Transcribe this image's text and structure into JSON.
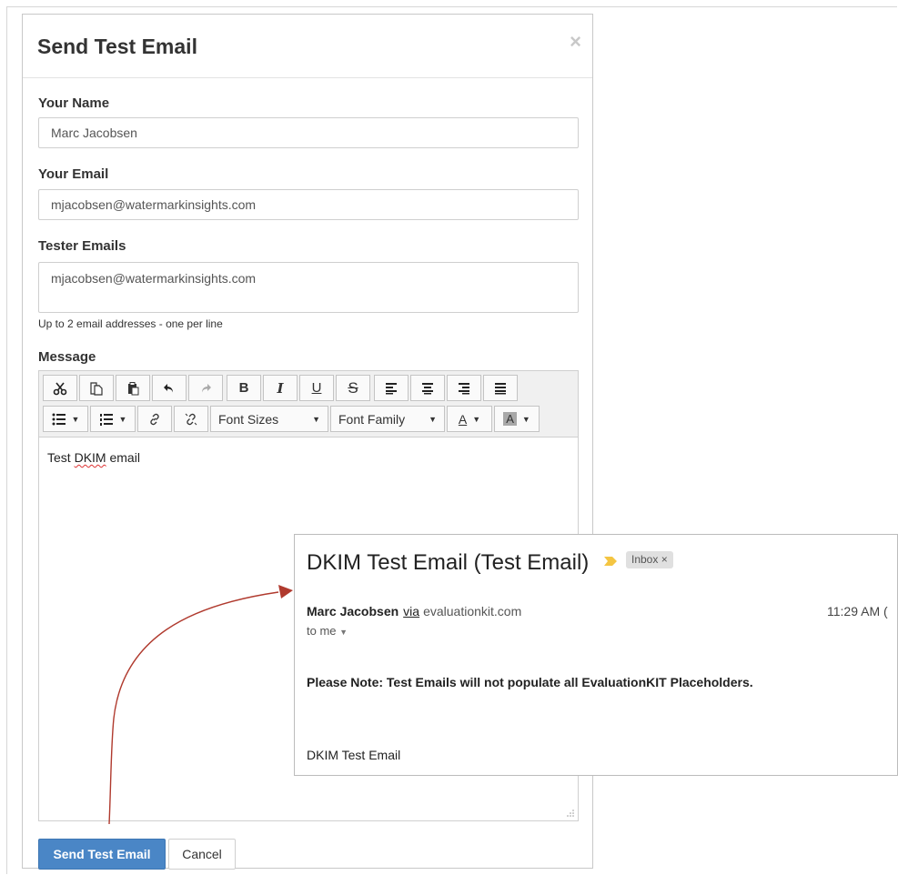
{
  "modal": {
    "title": "Send Test Email",
    "close_glyph": "×",
    "fields": {
      "name_label": "Your Name",
      "name_value": "Marc Jacobsen",
      "email_label": "Your Email",
      "email_value": "mjacobsen@watermarkinsights.com",
      "testers_label": "Tester Emails",
      "testers_value": "mjacobsen@watermarkinsights.com",
      "testers_help": "Up to 2 email addresses - one per line"
    },
    "message_label": "Message",
    "toolbar": {
      "font_sizes": "Font Sizes",
      "font_family": "Font Family",
      "bold": "B",
      "italic": "I",
      "underline": "U",
      "strike": "S",
      "text_color": "A",
      "bg_color": "A"
    },
    "editor": {
      "text_before": "Test ",
      "text_misspelled": "DKIM",
      "text_after": " email"
    },
    "buttons": {
      "send": "Send Test Email",
      "cancel": "Cancel"
    }
  },
  "email_preview": {
    "subject": "DKIM Test Email (Test Email)",
    "label_chip": "Inbox",
    "label_chip_close": "×",
    "sender_name": "Marc Jacobsen",
    "via": "via",
    "domain": "evaluationkit.com",
    "time": "11:29 AM (",
    "to": "to me",
    "note": "Please Note: Test Emails will not populate all EvaluationKIT Placeholders.",
    "body": "DKIM Test Email"
  },
  "colors": {
    "primary_button": "#4a86c6",
    "arrow": "#b03a2e",
    "importance_marker": "#f4c542"
  }
}
